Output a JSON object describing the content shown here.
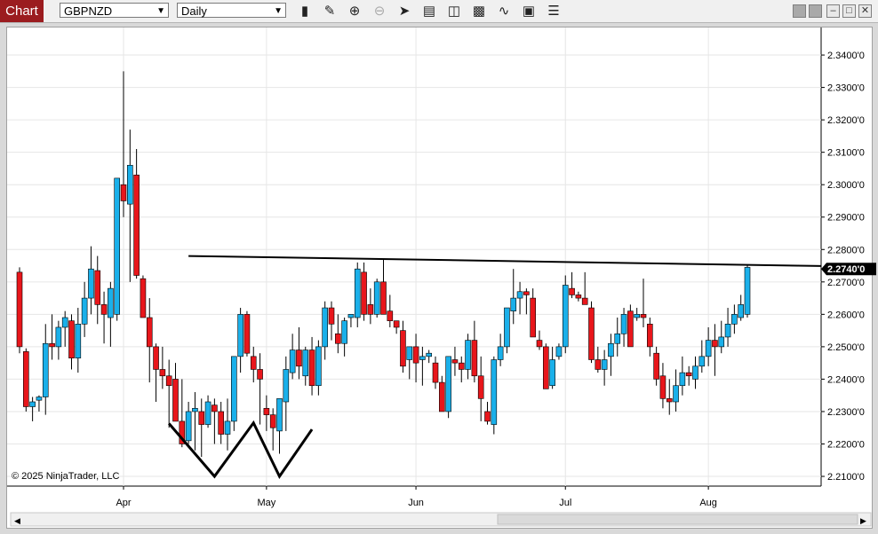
{
  "toolbar": {
    "chart_label": "Chart",
    "instrument": "GBPNZD",
    "period": "Daily",
    "icons": [
      "bar-type-icon",
      "drawing-tool-icon",
      "zoom-in-icon",
      "zoom-out-icon",
      "pointer-icon",
      "data-box-icon",
      "properties-icon",
      "indicators-icon",
      "strategy-icon",
      "templates-icon",
      "menu-icon"
    ]
  },
  "window_controls": [
    "tile-icon",
    "tile-icon",
    "minimize-icon",
    "maximize-icon",
    "close-icon"
  ],
  "copyright": "© 2025 NinjaTrader, LLC",
  "colors": {
    "up": "#1ab0ea",
    "down": "#e8161b",
    "wick": "#000000",
    "grid": "#e6e6e6",
    "price_marker_bg": "#000000"
  },
  "chart_data": {
    "type": "candlestick",
    "instrument": "GBPNZD",
    "period": "Daily",
    "x_labels": [
      "Apr",
      "May",
      "Jun",
      "Jul",
      "Aug"
    ],
    "y_ticks": [
      "2.3400'0",
      "2.3300'0",
      "2.3200'0",
      "2.3100'0",
      "2.3000'0",
      "2.2900'0",
      "2.2800'0",
      "2.2700'0",
      "2.2600'0",
      "2.2500'0",
      "2.2400'0",
      "2.2300'0",
      "2.2200'0",
      "2.2100'0"
    ],
    "ylim": [
      2.207,
      2.3485
    ],
    "last_price_label": "2.2740'0",
    "last_price": 2.274,
    "resistance_line": {
      "from": 2.278,
      "to": 2.2749
    },
    "w_pattern_lows": [
      2.21,
      2.21
    ],
    "candles": [
      [
        2.273,
        2.2745,
        2.248,
        2.25
      ],
      [
        2.2485,
        2.2495,
        2.23,
        2.2315
      ],
      [
        2.2315,
        2.2345,
        2.227,
        2.233
      ],
      [
        2.2335,
        2.235,
        2.23,
        2.2345
      ],
      [
        2.2345,
        2.257,
        2.229,
        2.251
      ],
      [
        2.251,
        2.26,
        2.246,
        2.25
      ],
      [
        2.25,
        2.258,
        2.246,
        2.256
      ],
      [
        2.256,
        2.261,
        2.25,
        2.259
      ],
      [
        2.258,
        2.26,
        2.243,
        2.2465
      ],
      [
        2.2465,
        2.262,
        2.242,
        2.257
      ],
      [
        2.257,
        2.27,
        2.253,
        2.265
      ],
      [
        2.265,
        2.281,
        2.26,
        2.274
      ],
      [
        2.2735,
        2.278,
        2.257,
        2.263
      ],
      [
        2.263,
        2.267,
        2.251,
        2.26
      ],
      [
        2.259,
        2.27,
        2.25,
        2.268
      ],
      [
        2.26,
        2.302,
        2.258,
        2.302
      ],
      [
        2.3,
        2.335,
        2.29,
        2.295
      ],
      [
        2.294,
        2.317,
        2.27,
        2.306
      ],
      [
        2.303,
        2.311,
        2.271,
        2.272
      ],
      [
        2.271,
        2.272,
        2.26,
        2.259
      ],
      [
        2.259,
        2.265,
        2.239,
        2.25
      ],
      [
        2.25,
        2.251,
        2.233,
        2.243
      ],
      [
        2.243,
        2.25,
        2.237,
        2.241
      ],
      [
        2.241,
        2.246,
        2.225,
        2.238
      ],
      [
        2.24,
        2.245,
        2.227,
        2.227
      ],
      [
        2.227,
        2.24,
        2.219,
        2.22
      ],
      [
        2.221,
        2.233,
        2.22,
        2.23
      ],
      [
        2.23,
        2.236,
        2.218,
        2.231
      ],
      [
        2.23,
        2.234,
        2.216,
        2.226
      ],
      [
        2.226,
        2.235,
        2.225,
        2.233
      ],
      [
        2.232,
        2.234,
        2.22,
        2.23
      ],
      [
        2.23,
        2.233,
        2.22,
        2.223
      ],
      [
        2.223,
        2.234,
        2.218,
        2.227
      ],
      [
        2.227,
        2.246,
        2.224,
        2.247
      ],
      [
        2.247,
        2.262,
        2.242,
        2.26
      ],
      [
        2.26,
        2.261,
        2.247,
        2.248
      ],
      [
        2.247,
        2.25,
        2.239,
        2.243
      ],
      [
        2.243,
        2.248,
        2.226,
        2.24
      ],
      [
        2.231,
        2.235,
        2.224,
        2.229
      ],
      [
        2.229,
        2.231,
        2.218,
        2.225
      ],
      [
        2.224,
        2.232,
        2.217,
        2.234
      ],
      [
        2.233,
        2.247,
        2.224,
        2.243
      ],
      [
        2.242,
        2.254,
        2.24,
        2.249
      ],
      [
        2.249,
        2.256,
        2.24,
        2.244
      ],
      [
        2.241,
        2.25,
        2.238,
        2.249
      ],
      [
        2.249,
        2.253,
        2.235,
        2.238
      ],
      [
        2.238,
        2.252,
        2.235,
        2.25
      ],
      [
        2.25,
        2.264,
        2.246,
        2.262
      ],
      [
        2.262,
        2.264,
        2.252,
        2.257
      ],
      [
        2.254,
        2.26,
        2.248,
        2.251
      ],
      [
        2.251,
        2.259,
        2.247,
        2.258
      ],
      [
        2.259,
        2.26,
        2.256,
        2.26
      ],
      [
        2.259,
        2.276,
        2.256,
        2.274
      ],
      [
        2.273,
        2.276,
        2.258,
        2.26
      ],
      [
        2.263,
        2.268,
        2.257,
        2.26
      ],
      [
        2.26,
        2.271,
        2.259,
        2.27
      ],
      [
        2.27,
        2.277,
        2.26,
        2.26
      ],
      [
        2.261,
        2.266,
        2.256,
        2.258
      ],
      [
        2.258,
        2.258,
        2.254,
        2.256
      ],
      [
        2.255,
        2.258,
        2.242,
        2.244
      ],
      [
        2.246,
        2.25,
        2.24,
        2.25
      ],
      [
        2.25,
        2.254,
        2.239,
        2.245
      ],
      [
        2.246,
        2.25,
        2.238,
        2.247
      ],
      [
        2.247,
        2.249,
        2.245,
        2.248
      ],
      [
        2.245,
        2.247,
        2.237,
        2.239
      ],
      [
        2.239,
        2.241,
        2.23,
        2.23
      ],
      [
        2.23,
        2.247,
        2.228,
        2.247
      ],
      [
        2.246,
        2.25,
        2.241,
        2.245
      ],
      [
        2.245,
        2.247,
        2.239,
        2.243
      ],
      [
        2.243,
        2.254,
        2.24,
        2.252
      ],
      [
        2.252,
        2.258,
        2.239,
        2.241
      ],
      [
        2.241,
        2.247,
        2.227,
        2.234
      ],
      [
        2.23,
        2.233,
        2.226,
        2.227
      ],
      [
        2.226,
        2.247,
        2.223,
        2.246
      ],
      [
        2.246,
        2.254,
        2.244,
        2.25
      ],
      [
        2.25,
        2.262,
        2.248,
        2.262
      ],
      [
        2.261,
        2.274,
        2.257,
        2.265
      ],
      [
        2.265,
        2.27,
        2.26,
        2.267
      ],
      [
        2.267,
        2.268,
        2.26,
        2.266
      ],
      [
        2.265,
        2.268,
        2.254,
        2.253
      ],
      [
        2.252,
        2.255,
        2.249,
        2.25
      ],
      [
        2.25,
        2.251,
        2.237,
        2.237
      ],
      [
        2.238,
        2.25,
        2.237,
        2.246
      ],
      [
        2.247,
        2.251,
        2.246,
        2.25
      ],
      [
        2.25,
        2.272,
        2.248,
        2.269
      ],
      [
        2.268,
        2.273,
        2.265,
        2.266
      ],
      [
        2.266,
        2.267,
        2.264,
        2.265
      ],
      [
        2.265,
        2.273,
        2.264,
        2.263
      ],
      [
        2.262,
        2.264,
        2.245,
        2.246
      ],
      [
        2.246,
        2.25,
        2.242,
        2.243
      ],
      [
        2.243,
        2.249,
        2.238,
        2.246
      ],
      [
        2.247,
        2.254,
        2.241,
        2.251
      ],
      [
        2.251,
        2.259,
        2.247,
        2.254
      ],
      [
        2.254,
        2.262,
        2.25,
        2.26
      ],
      [
        2.261,
        2.263,
        2.251,
        2.25
      ],
      [
        2.259,
        2.262,
        2.258,
        2.26
      ],
      [
        2.26,
        2.271,
        2.256,
        2.259
      ],
      [
        2.257,
        2.259,
        2.247,
        2.25
      ],
      [
        2.248,
        2.25,
        2.238,
        2.24
      ],
      [
        2.241,
        2.245,
        2.231,
        2.234
      ],
      [
        2.234,
        2.24,
        2.229,
        2.233
      ],
      [
        2.233,
        2.243,
        2.23,
        2.238
      ],
      [
        2.238,
        2.247,
        2.235,
        2.242
      ],
      [
        2.242,
        2.244,
        2.238,
        2.241
      ],
      [
        2.24,
        2.247,
        2.237,
        2.244
      ],
      [
        2.244,
        2.252,
        2.242,
        2.247
      ],
      [
        2.247,
        2.256,
        2.244,
        2.252
      ],
      [
        2.252,
        2.257,
        2.241,
        2.25
      ],
      [
        2.25,
        2.258,
        2.248,
        2.253
      ],
      [
        2.253,
        2.262,
        2.25,
        2.257
      ],
      [
        2.257,
        2.263,
        2.254,
        2.26
      ],
      [
        2.259,
        2.266,
        2.258,
        2.263
      ],
      [
        2.26,
        2.275,
        2.259,
        2.2745
      ]
    ]
  }
}
